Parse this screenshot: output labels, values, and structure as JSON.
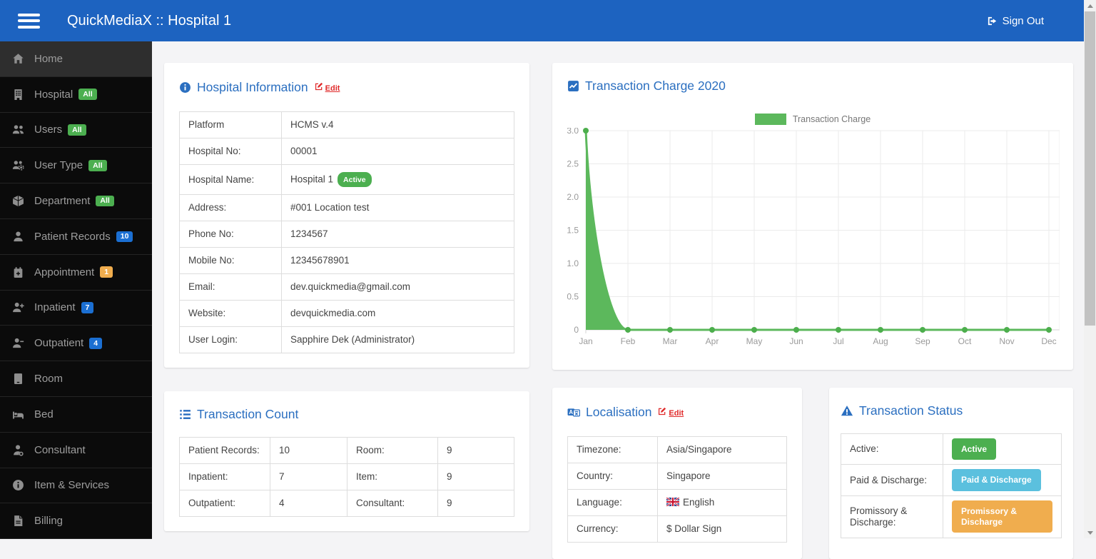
{
  "navbar": {
    "title": "QuickMediaX :: Hospital 1",
    "sign_out_label": "Sign Out"
  },
  "sidebar": {
    "items": [
      {
        "label": "Home",
        "icon": "home",
        "active": true
      },
      {
        "label": "Hospital",
        "icon": "hospital",
        "badge": {
          "text": "All",
          "color": "green"
        }
      },
      {
        "label": "Users",
        "icon": "users",
        "badge": {
          "text": "All",
          "color": "green"
        }
      },
      {
        "label": "User Type",
        "icon": "user-type",
        "badge": {
          "text": "All",
          "color": "green"
        }
      },
      {
        "label": "Department",
        "icon": "department",
        "badge": {
          "text": "All",
          "color": "green"
        }
      },
      {
        "label": "Patient Records",
        "icon": "patient",
        "badge": {
          "text": "10",
          "color": "blue"
        }
      },
      {
        "label": "Appointment",
        "icon": "appointment",
        "badge": {
          "text": "1",
          "color": "orange"
        }
      },
      {
        "label": "Inpatient",
        "icon": "inpatient",
        "badge": {
          "text": "7",
          "color": "blue"
        }
      },
      {
        "label": "Outpatient",
        "icon": "outpatient",
        "badge": {
          "text": "4",
          "color": "blue"
        }
      },
      {
        "label": "Room",
        "icon": "room"
      },
      {
        "label": "Bed",
        "icon": "bed"
      },
      {
        "label": "Consultant",
        "icon": "consultant"
      },
      {
        "label": "Item & Services",
        "icon": "info"
      },
      {
        "label": "Billing",
        "icon": "billing"
      }
    ]
  },
  "hospital_info": {
    "title": "Hospital Information",
    "edit_label": "Edit",
    "rows": [
      {
        "label": "Platform",
        "value": "HCMS v.4"
      },
      {
        "label": "Hospital No:",
        "value": "00001"
      },
      {
        "label": "Hospital Name:",
        "value": "Hospital 1",
        "badge": "Active"
      },
      {
        "label": "Address:",
        "value": "#001 Location test"
      },
      {
        "label": "Phone No:",
        "value": "1234567"
      },
      {
        "label": "Mobile No:",
        "value": "12345678901"
      },
      {
        "label": "Email:",
        "value": "dev.quickmedia@gmail.com"
      },
      {
        "label": "Website:",
        "value": "devquickmedia.com"
      },
      {
        "label": "User Login:",
        "value": "Sapphire Dek (Administrator)"
      }
    ]
  },
  "chart_data": {
    "type": "area",
    "title": "Transaction Charge 2020",
    "categories": [
      "Jan",
      "Feb",
      "Mar",
      "Apr",
      "May",
      "Jun",
      "Jul",
      "Aug",
      "Sep",
      "Oct",
      "Nov",
      "Dec"
    ],
    "series": [
      {
        "name": "Transaction Charge",
        "values": [
          3,
          0,
          0,
          0,
          0,
          0,
          0,
          0,
          0,
          0,
          0,
          0
        ]
      }
    ],
    "ylim": [
      0,
      3
    ],
    "yticks": [
      0,
      0.5,
      1.0,
      1.5,
      2.0,
      2.5,
      3.0
    ],
    "grid": true,
    "legend_position": "top-center",
    "series_color": "#5cb85c",
    "point_color": "#4cae4c"
  },
  "transaction_count": {
    "title": "Transaction Count",
    "rows": [
      [
        {
          "label": "Patient Records:",
          "value": "10"
        },
        {
          "label": "Room:",
          "value": "9"
        }
      ],
      [
        {
          "label": "Inpatient:",
          "value": "7"
        },
        {
          "label": "Item:",
          "value": "9"
        }
      ],
      [
        {
          "label": "Outpatient:",
          "value": "4"
        },
        {
          "label": "Consultant:",
          "value": "9"
        }
      ]
    ]
  },
  "localisation": {
    "title": "Localisation",
    "edit_label": "Edit",
    "rows": [
      {
        "label": "Timezone:",
        "value": "Asia/Singapore"
      },
      {
        "label": "Country:",
        "value": "Singapore"
      },
      {
        "label": "Language:",
        "value": "English",
        "flag": "gb"
      },
      {
        "label": "Currency:",
        "value": "$ Dollar Sign"
      }
    ]
  },
  "transaction_status": {
    "title": "Transaction Status",
    "rows": [
      {
        "label": "Active:",
        "button": {
          "text": "Active",
          "color": "#4caf50"
        }
      },
      {
        "label": "Paid & Discharge:",
        "button": {
          "text": "Paid & Discharge",
          "color": "#5bc0de"
        }
      },
      {
        "label": "Promissory & Discharge:",
        "button": {
          "text": "Promissory & Discharge",
          "color": "#f0ad4e"
        }
      }
    ]
  },
  "colors": {
    "navbar_blue": "#1d63c0",
    "panel_title_blue": "#2b6fc0",
    "edit_red": "#e02b2b",
    "badge_green": "#4caf50",
    "badge_blue": "#1b6fd2",
    "badge_orange": "#f0ad4e",
    "chart_green": "#5cb85c",
    "status_info_blue": "#5bc0de",
    "sidebar_bg": "#0b0b0b"
  }
}
